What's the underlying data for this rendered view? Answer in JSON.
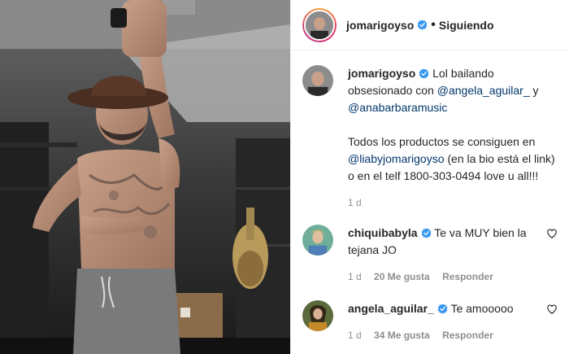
{
  "post": {
    "author": "jomarigoyso",
    "follow_status": "Siguiendo",
    "separator": "•"
  },
  "caption": {
    "username": "jomarigoyso",
    "part1": "Lol bailando obsesionado con ",
    "mention1": "@angela_aguilar_",
    "part2": " y ",
    "mention2": "@anabarbaramusic",
    "p2_part1": "Todos los productos se consiguen en ",
    "mention3": "@liabyjomarigoyso",
    "p2_part2": " (en la bio está el link) o en el telf 1800-303-0494 love u all!!!",
    "time": "1 d"
  },
  "comments": [
    {
      "username": "chiquibabyla",
      "text": "Te va MUY bien la tejana JO",
      "time": "1 d",
      "likes": "20 Me gusta",
      "reply": "Responder"
    },
    {
      "username": "angela_aguilar_",
      "text": "Te amooooo",
      "time": "1 d",
      "likes": "34 Me gusta",
      "reply": "Responder"
    }
  ],
  "colors": {
    "verified": "#3897f0",
    "mention": "#00376b",
    "meta": "#8e8e8e"
  },
  "icons": {
    "verified": "verified-badge-icon",
    "like": "heart-outline-icon"
  }
}
